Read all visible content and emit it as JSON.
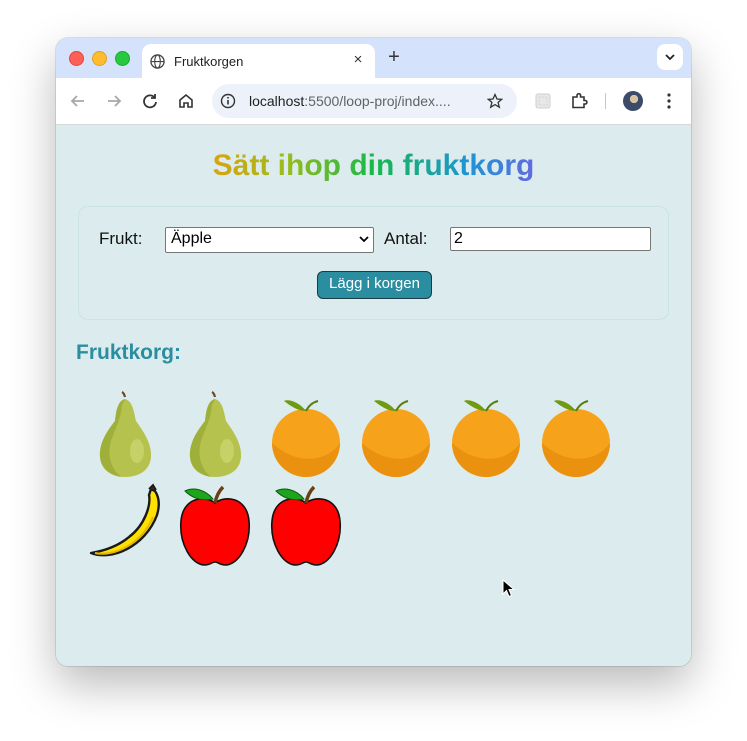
{
  "browser": {
    "tab_title": "Fruktkorgen",
    "tab_close": "×",
    "new_tab": "+",
    "url_host": "localhost",
    "url_path": ":5500/loop-proj/index...."
  },
  "page": {
    "title": "Sätt ihop din fruktkorg",
    "form": {
      "fruit_label": "Frukt:",
      "fruit_selected": "Äpple",
      "quantity_label": "Antal:",
      "quantity_value": "2",
      "add_button": "Lägg i korgen"
    },
    "basket_heading": "Fruktkorg:",
    "basket_items": [
      "pear",
      "pear",
      "orange",
      "orange",
      "orange",
      "orange",
      "banana",
      "apple",
      "apple"
    ]
  },
  "colors": {
    "page_background": "#dcecee",
    "accent": "#2b8da0",
    "tab_strip": "#d4e2fb"
  }
}
